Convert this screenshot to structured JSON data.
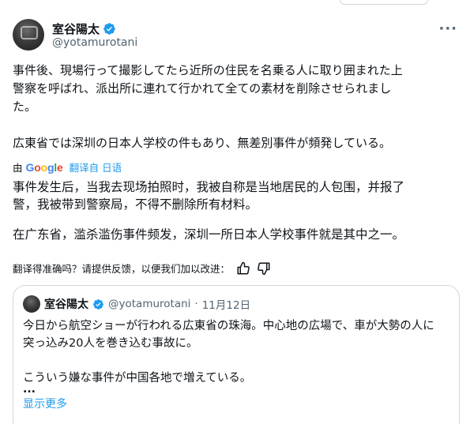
{
  "author": {
    "display_name": "室谷陽太",
    "handle": "@yotamurotani",
    "more_icon": "more-horizontal-icon"
  },
  "tweet": {
    "lines": [
      "事件後、現場行って撮影してたら近所の住民を名乗る人に取り囲まれた上",
      "警察を呼ばれ、派出所に連れて行かれて全ての素材を削除させられまし",
      "た。",
      "広東省では深圳の日本人学校の件もあり、無差別事件が頻発している。"
    ]
  },
  "translation_bar": {
    "prefix": "由",
    "provider": [
      "G",
      "o",
      "o",
      "g",
      "l",
      "e"
    ],
    "link": "翻译自 日语"
  },
  "translation": {
    "para1_lines": [
      "事件发生后，当我去现场拍照时，我被自称是当地居民的人包围，并报了",
      "警，我被带到警察局，不得不删除所有材料。"
    ],
    "para2": "在广东省，滥杀滥伤事件频发，深圳一所日本人学校事件就是其中之一。"
  },
  "feedback": {
    "question": "翻译得准确吗？请提供反馈，以便我们加以改进：",
    "up_icon": "thumbs-up-icon",
    "down_icon": "thumbs-down-icon"
  },
  "quote": {
    "display_name": "室谷陽太",
    "handle": "@yotamurotani",
    "separator": "·",
    "date": "11月12日",
    "lines": [
      "今日から航空ショーが行われる広東省の珠海。中心地の広場で、車が大勢の人に",
      "突っ込み20人を巻き込む事故に。",
      "こういう嫌な事件が中国各地で増えている。"
    ],
    "ellipsis": "...",
    "show_more": "显示更多"
  },
  "colors": {
    "accent": "#1d9bf0",
    "text": "#0f1419",
    "muted": "#536471",
    "border": "#cfd9de"
  }
}
